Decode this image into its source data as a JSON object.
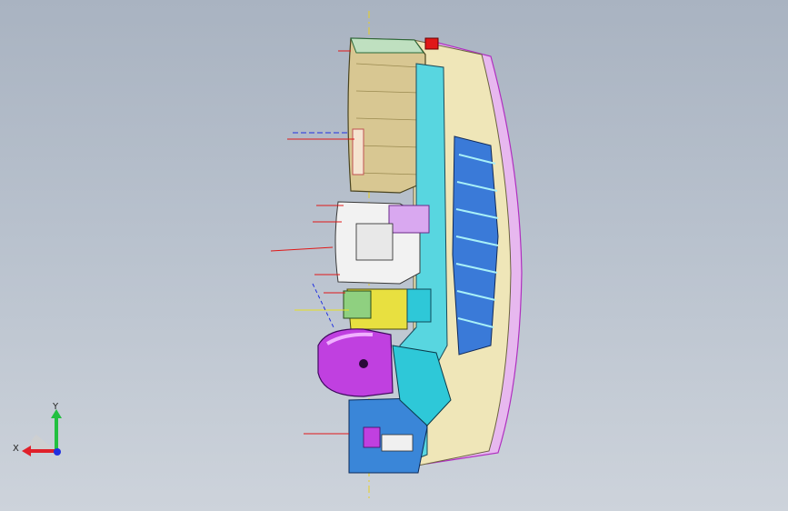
{
  "viewport": {
    "background_top": "#a9b3c1",
    "background_bottom": "#cdd3db"
  },
  "triad": {
    "x_label": "X",
    "y_label": "Y",
    "x_color": "#e0202a",
    "y_color": "#22c040",
    "z_color": "#2030e0"
  },
  "model": {
    "colors": {
      "tan": "#d8c792",
      "cream": "#efe6b8",
      "cyan": "#2ec8d8",
      "blue": "#2a62c8",
      "magenta": "#c040e0",
      "pink": "#e070f0",
      "yellow": "#e8e040",
      "green": "#8fd080",
      "white": "#f2f2f2",
      "red": "#e01818",
      "dark": "#1a2a3a"
    }
  }
}
